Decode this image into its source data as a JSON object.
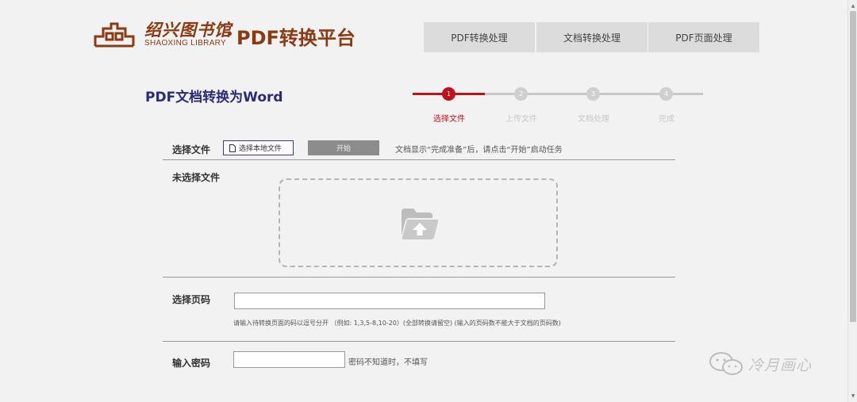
{
  "header": {
    "logo_cn": "绍兴图书馆",
    "logo_en": "SHAOXING LIBRARY",
    "app_title": "PDF转换平台",
    "nav": [
      "PDF转换处理",
      "文档转换处理",
      "PDF页面处理"
    ]
  },
  "page": {
    "title": "PDF文档转换为Word"
  },
  "steps": [
    {
      "number": "1",
      "label": "选择文件"
    },
    {
      "number": "2",
      "label": "上传文件"
    },
    {
      "number": "3",
      "label": "文档处理"
    },
    {
      "number": "4",
      "label": "完成"
    }
  ],
  "select_file": {
    "label": "选择文件",
    "choose_button": "选择本地文件",
    "start_button": "开始",
    "hint": "文档显示“完成准备”后，请点击“开始”启动任务",
    "status": "未选择文件"
  },
  "pages": {
    "label": "选择页码",
    "value": "",
    "help": "请输入待转换页面的码以逗号分开 （例如: 1,3,5-8,10-20）(全部转换请留空) (输入的页码数不能大于文档的页码数)"
  },
  "password": {
    "label": "输入密码",
    "value": "",
    "hint": "密码不知道时，不填写"
  },
  "watermark": {
    "text": "冷月画心"
  },
  "colors": {
    "brand": "#8b3a12",
    "accent": "#c0111b",
    "title": "#2a2a7a"
  }
}
